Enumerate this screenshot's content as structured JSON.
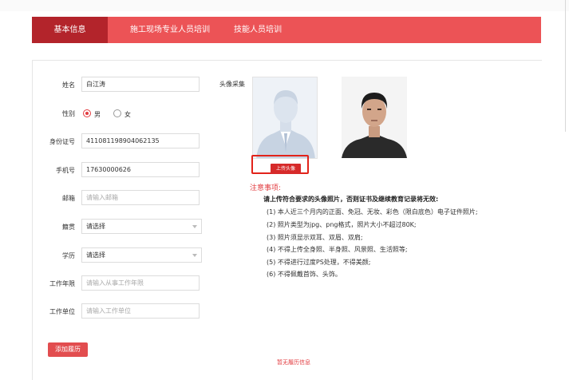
{
  "tabs": [
    {
      "label": "基本信息",
      "active": true
    },
    {
      "label": "施工现场专业人员培训",
      "active": false
    },
    {
      "label": "技能人员培训",
      "active": false
    }
  ],
  "form": {
    "name": {
      "label": "姓名",
      "value": "白江涛"
    },
    "gender": {
      "label": "性别",
      "options": [
        "男",
        "女"
      ],
      "selected": "男"
    },
    "id_number": {
      "label": "身份证号",
      "value": "411081198904062135"
    },
    "phone": {
      "label": "手机号",
      "value": "17630000626"
    },
    "email": {
      "label": "邮箱",
      "placeholder": "请输入邮箱"
    },
    "native_place": {
      "label": "籍贯",
      "value": "请选择"
    },
    "education": {
      "label": "学历",
      "value": "请选择"
    },
    "work_years": {
      "label": "工作年限",
      "placeholder": "请输入从事工作年限"
    },
    "employer": {
      "label": "工作单位",
      "placeholder": "请输入工作单位"
    }
  },
  "photo": {
    "label": "头像采集",
    "upload_button": "上传头像"
  },
  "notice": {
    "title": "注意事项:",
    "heading": "请上传符合要求的头像照片，否则证书及继续教育记录将无效:",
    "items": [
      "(1)  本人近三个月内的正面、免冠、无妆、彩色（限白底色）电子证件照片;",
      "(2)  照片类型为jpg、png格式，照片大小不超过80K;",
      "(3)  照片须显示双耳、双眉、双肩;",
      "(4)  不得上传全身照、半身照、风景照、生活照等;",
      "(5)  不得进行过度PS处理，不得美颜;",
      "(6)  不得佩戴首饰、头饰。"
    ]
  },
  "add_resume_button": "添加履历",
  "empty_resume_text": "暂无履历信息",
  "colors": {
    "accent": "#ec5356",
    "active_tab": "#b3242b",
    "alert": "#e2231a"
  }
}
